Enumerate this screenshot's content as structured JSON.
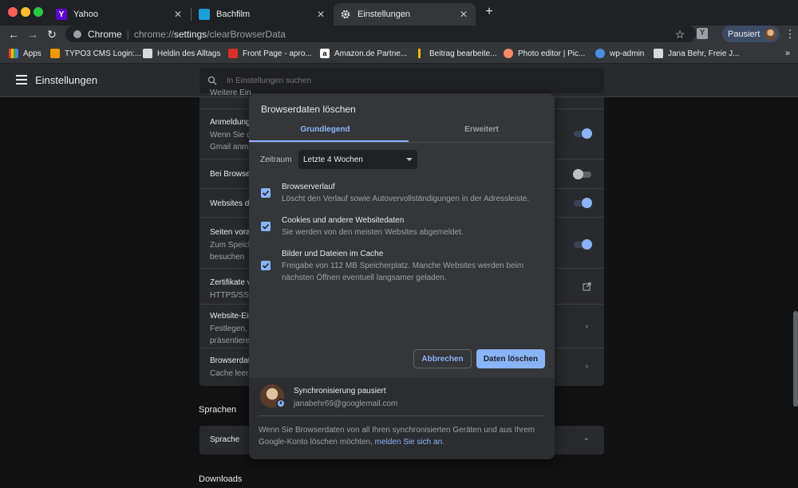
{
  "tabs": [
    {
      "title": "Yahoo",
      "favicon": "Y",
      "favicon_color": "#5f01d1",
      "active": false
    },
    {
      "title": "Bachfilm",
      "favicon": "",
      "favicon_color": "#1a9fd9",
      "active": false
    },
    {
      "title": "Einstellungen",
      "favicon": "gear",
      "favicon_color": "#35363a",
      "active": true
    }
  ],
  "omnibox": {
    "label": "Chrome",
    "url_prefix": "chrome://",
    "url_host": "settings",
    "url_path": "/clearBrowserData"
  },
  "profile": {
    "status": "Pausiert"
  },
  "bookmarks": [
    {
      "label": "Apps",
      "color": "#e8453c"
    },
    {
      "label": "TYPO3 CMS Login:...",
      "color": "#f49700"
    },
    {
      "label": "Heldin des Alltags",
      "color": "#d9d9d9"
    },
    {
      "label": "Front Page - apro...",
      "color": "#d93025"
    },
    {
      "label": "Amazon.de Partne...",
      "color": "#ffffff"
    },
    {
      "label": "Beitrag bearbeite...",
      "color": "#f4b400"
    },
    {
      "label": "Photo editor | Pic...",
      "color": "#ff8a65"
    },
    {
      "label": "wp-admin",
      "color": "#4a90e2"
    },
    {
      "label": "Jana Behr, Freie J...",
      "color": "#d9d9d9"
    }
  ],
  "settings": {
    "title": "Einstellungen",
    "search_placeholder": "In Einstellungen suchen",
    "rows": [
      {
        "title": "Weitere Ein",
        "desc": ""
      },
      {
        "title": "Anmeldung",
        "desc": "Wenn Sie d",
        "desc2": "Gmail anme"
      },
      {
        "title": "Bei Browse",
        "desc": ""
      },
      {
        "title": "Websites d",
        "desc": ""
      },
      {
        "title": "Seiten vora",
        "desc": "Zum Speich",
        "desc2": "besuchen"
      },
      {
        "title": "Zertifikate v",
        "desc": "HTTPS/SSL"
      },
      {
        "title": "Website-Ein",
        "desc": "Festlegen, w",
        "desc2": "präsentiere"
      },
      {
        "title": "Browserdat",
        "desc": "Cache leere"
      }
    ],
    "section_languages": "Sprachen",
    "lang_row": "Sprache",
    "section_downloads": "Downloads"
  },
  "dialog": {
    "title": "Browserdaten löschen",
    "tab_basic": "Grundlegend",
    "tab_advanced": "Erweitert",
    "range_label": "Zeitraum",
    "range_value": "Letzte 4 Wochen",
    "options": [
      {
        "title": "Browserverlauf",
        "desc": "Löscht den Verlauf sowie Autovervollständigungen in der Adressleiste.",
        "checked": true
      },
      {
        "title": "Cookies und andere Websitedaten",
        "desc": "Sie werden von den meisten Websites abgemeldet.",
        "checked": true
      },
      {
        "title": "Bilder und Dateien im Cache",
        "desc": "Freigabe von 112 MB Speicherplatz. Manche Websites werden beim nächsten Öffnen eventuell langsamer geladen.",
        "checked": true
      }
    ],
    "cancel": "Abbrechen",
    "confirm": "Daten löschen",
    "sync_title": "Synchronisierung pausiert",
    "sync_email": "janabehr69@googlemail.com",
    "sync_note": "Wenn Sie Browserdaten von all Ihren synchronisierten Geräten und aus Ihrem Google-Konto löschen möchten,",
    "sync_link": "melden Sie sich an",
    "sync_note_end": "."
  },
  "colors": {
    "accent": "#8ab4f8",
    "bg": "#202124",
    "card": "#292a2d",
    "dialog": "#35363a"
  }
}
